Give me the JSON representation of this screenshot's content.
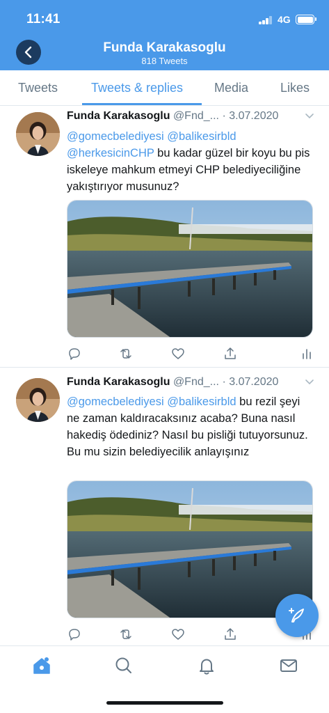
{
  "status": {
    "time": "11:41",
    "network": "4G"
  },
  "header": {
    "title": "Funda Karakasoglu",
    "subtitle": "818 Tweets"
  },
  "tabs": [
    "Tweets",
    "Tweets & replies",
    "Media",
    "Likes"
  ],
  "tweets": [
    {
      "name": "Funda Karakasoglu",
      "handle": "@Fnd_...",
      "sep": "·",
      "date": "3.07.2020",
      "mentions": [
        "@gomecbelediyesi",
        "@balikesirbld",
        "@herkesicinCHP"
      ],
      "text": "bu kadar güzel bir koyu bu pis iskeleye mahkum etmeyi CHP belediyeciliğine yakıştırıyor musunuz?"
    },
    {
      "name": "Funda Karakasoglu",
      "handle": "@Fnd_...",
      "sep": "·",
      "date": "3.07.2020",
      "mentions": [
        "@gomecbelediyesi",
        "@balikesirbld"
      ],
      "text": "bu rezil şeyi ne zaman kaldıracaksınız acaba? Buna nasıl hakediş ödediniz? Nasıl bu pisliği tutuyorsunuz. Bu mu sizin belediyecilik anlayışınız"
    }
  ],
  "icons": {
    "back": "chevron-left-icon",
    "reply": "reply-icon",
    "retweet": "retweet-icon",
    "like": "heart-icon",
    "share": "share-icon",
    "analytics": "analytics-icon",
    "compose": "compose-tweet-icon",
    "home": "home-icon",
    "search": "search-icon",
    "notifications": "bell-icon",
    "messages": "mail-icon"
  },
  "colors": {
    "accent": "#4a99e9",
    "text": "#14171a",
    "muted": "#657786",
    "back_button": "#1c3b5f"
  }
}
